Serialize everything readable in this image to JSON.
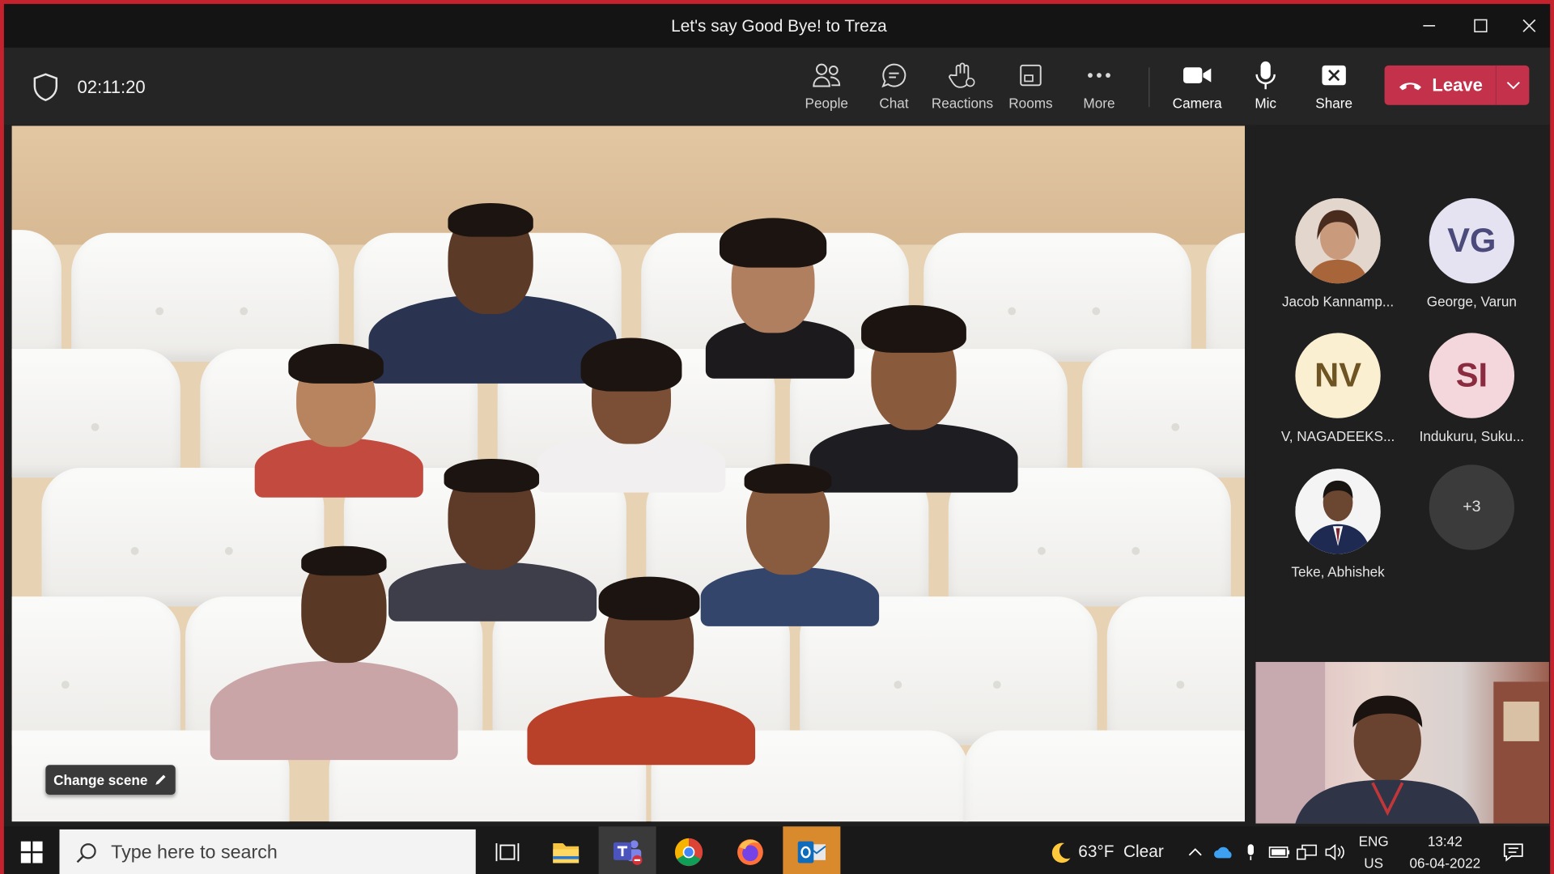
{
  "window": {
    "title": "Let's say Good Bye! to Treza"
  },
  "meeting": {
    "timer": "02:11:20"
  },
  "toolbar": {
    "people": "People",
    "chat": "Chat",
    "reactions": "Reactions",
    "rooms": "Rooms",
    "more": "More",
    "camera": "Camera",
    "mic": "Mic",
    "share": "Share",
    "leave": "Leave"
  },
  "stage": {
    "change_scene": "Change scene"
  },
  "participants": [
    {
      "initials": "",
      "name": "Jacob Kannamp...",
      "type": "photo"
    },
    {
      "initials": "VG",
      "name": "George, Varun",
      "bg": "#e5e3f2",
      "fg": "#4b4a7a"
    },
    {
      "initials": "NV",
      "name": "V, NAGADEEKS...",
      "bg": "#fbefd2",
      "fg": "#6e5423"
    },
    {
      "initials": "SI",
      "name": "Indukuru, Suku...",
      "bg": "#f3d7dc",
      "fg": "#8b2b40"
    },
    {
      "initials": "",
      "name": "Teke, Abhishek",
      "type": "photo"
    }
  ],
  "overflow": {
    "label": "+3"
  },
  "taskbar": {
    "search_placeholder": "Type here to search",
    "weather": "63°F  Clear",
    "lang_line1": "ENG",
    "lang_line2": "US",
    "time": "13:42",
    "date": "06-04-2022"
  },
  "colors": {
    "accent_leave": "#c4314b",
    "window_border": "#c4222d",
    "taskbar_active": "#76b9ed"
  }
}
